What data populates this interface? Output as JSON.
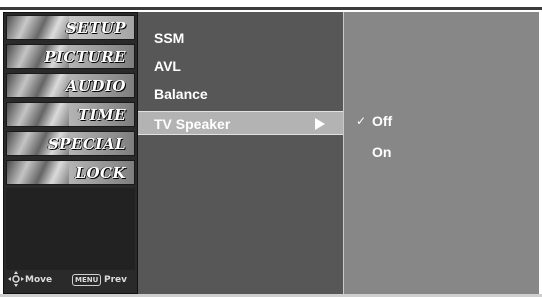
{
  "sidebar": {
    "items": [
      {
        "label": "SETUP",
        "icon": "satellite-icon"
      },
      {
        "label": "PICTURE",
        "icon": "film-strip-icon"
      },
      {
        "label": "AUDIO",
        "icon": "speaker-icon"
      },
      {
        "label": "TIME",
        "icon": "clock-icon"
      },
      {
        "label": "SPECIAL",
        "icon": "special-badge-icon"
      },
      {
        "label": "LOCK",
        "icon": "lock-icon"
      }
    ],
    "help": {
      "move": "Move",
      "menu_key": "MENU",
      "prev": "Prev"
    }
  },
  "menu": {
    "items": [
      {
        "label": "SSM"
      },
      {
        "label": "AVL"
      },
      {
        "label": "Balance"
      },
      {
        "label": "TV Speaker"
      }
    ],
    "selected_index": 3
  },
  "submenu": {
    "options": [
      {
        "label": "Off",
        "checked": "✓"
      },
      {
        "label": "On",
        "checked": ""
      }
    ]
  },
  "colors": {
    "sidebar_bg": "#2a2a2a",
    "menu_bg": "#575757",
    "submenu_bg": "#878787",
    "highlight": "#b3b3b3",
    "text": "#ffffff"
  }
}
